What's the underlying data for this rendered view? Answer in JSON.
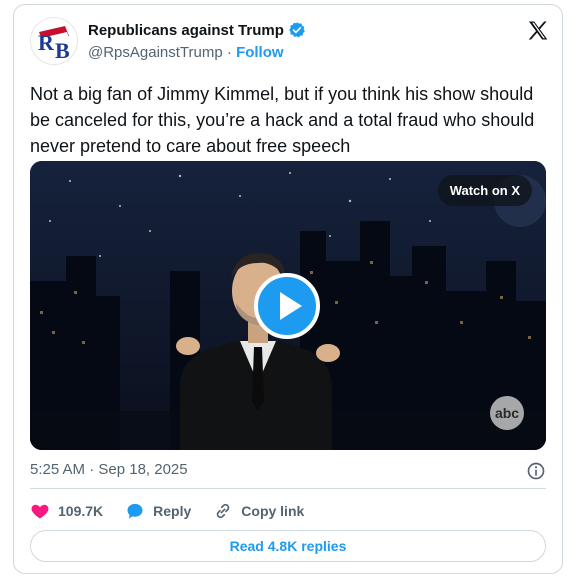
{
  "author": {
    "name": "Republicans against Trump",
    "handle": "@RpsAgainstTrump",
    "separator": "·",
    "follow_label": "Follow"
  },
  "tweet": {
    "text": "Not a big fan of Jimmy Kimmel, but if you think his show should be canceled for this, you’re a hack and a total fraud who should never pretend to care about free speech",
    "timestamp": "5:25 AM · Sep 18, 2025"
  },
  "media": {
    "watch_label": "Watch on X",
    "network_logo": "abc",
    "play_icon": "play-icon"
  },
  "actions": {
    "likes": "109.7K",
    "reply_label": "Reply",
    "copy_link_label": "Copy link"
  },
  "replies_button": "Read 4.8K replies",
  "colors": {
    "accent": "#1d9bf0",
    "like": "#f91880",
    "text": "#0f1419",
    "muted": "#536471",
    "border": "#cfd9de"
  },
  "icons": {
    "verified": "verified-badge-icon",
    "x": "x-logo-icon",
    "info": "info-icon",
    "heart": "heart-icon",
    "reply": "reply-bubble-icon",
    "link": "link-icon"
  }
}
